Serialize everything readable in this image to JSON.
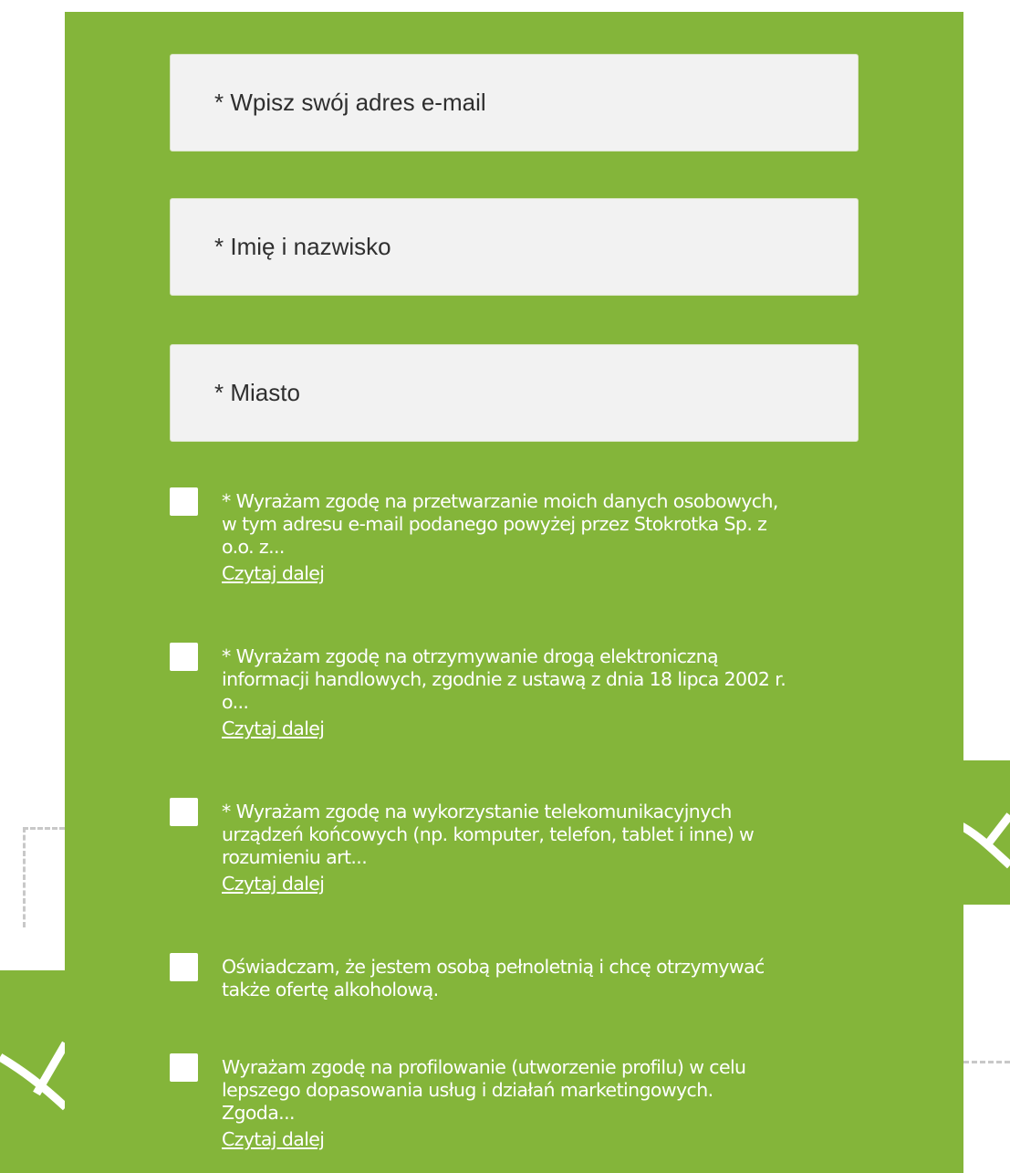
{
  "colors": {
    "panel_green": "#84b53a",
    "field_bg": "#f2f2f2",
    "text_white": "#ffffff"
  },
  "form": {
    "fields": [
      {
        "placeholder": "* Wpisz swój adres e-mail",
        "value": ""
      },
      {
        "placeholder": "* Imię i nazwisko",
        "value": ""
      },
      {
        "placeholder": "* Miasto",
        "value": ""
      }
    ],
    "consents": [
      {
        "checked": false,
        "lines": [
          "* Wyrażam zgodę na przetwarzanie moich danych osobowych,",
          "w tym adresu e-mail podanego powyżej przez Stokrotka Sp. z",
          "o.o. z..."
        ],
        "read_more": "Czytaj dalej"
      },
      {
        "checked": false,
        "lines": [
          "* Wyrażam zgodę na otrzymywanie drogą elektroniczną",
          "informacji handlowych, zgodnie z ustawą z dnia 18 lipca 2002 r.",
          "o..."
        ],
        "read_more": "Czytaj dalej"
      },
      {
        "checked": false,
        "lines": [
          "* Wyrażam zgodę na wykorzystanie telekomunikacyjnych",
          "urządzeń końcowych (np. komputer, telefon, tablet i inne) w",
          "rozumieniu art..."
        ],
        "read_more": "Czytaj dalej"
      },
      {
        "checked": false,
        "lines": [
          "Oświadczam, że jestem osobą pełnoletnią i chcę otrzymywać",
          "także ofertę alkoholową."
        ],
        "read_more": ""
      },
      {
        "checked": false,
        "lines": [
          "Wyrażam zgodę na profilowanie (utworzenie profilu) w celu",
          "lepszego dopasowania usług i działań marketingowych.",
          "Zgoda..."
        ],
        "read_more": "Czytaj dalej"
      }
    ]
  }
}
